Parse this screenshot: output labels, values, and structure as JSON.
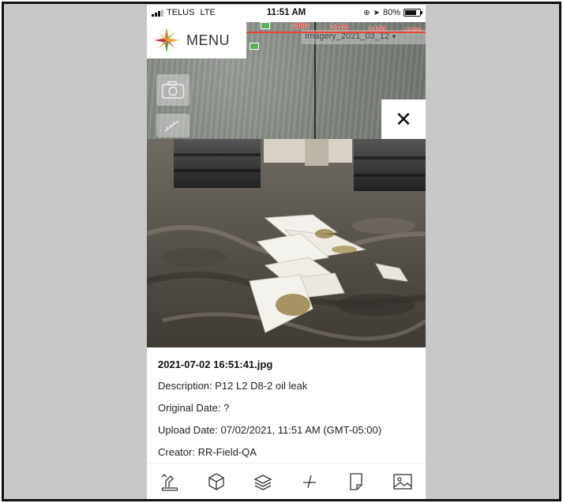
{
  "status_bar": {
    "carrier": "TELUS",
    "network": "LTE",
    "time": "11:51 AM",
    "battery": "80%"
  },
  "map": {
    "menu_label": "MENU",
    "layer_select": "Imagery_2021_03_12",
    "contour_labels": [
      "2480",
      "2470",
      "2460",
      "2450"
    ],
    "tools": [
      "camera-icon",
      "ruler-icon"
    ]
  },
  "photo": {
    "filename": "2021-07-02 16:51:41.jpg",
    "description": "Description: P12 L2 D8-2 oil leak",
    "original_date": "Original Date: ?",
    "upload_date": "Upload Date: 07/02/2021, 11:51 AM (GMT-05:00)",
    "creator": "Creator: RR-Field-QA"
  },
  "toolbar": {
    "items": [
      "excavator-icon",
      "box-icon",
      "layers-icon",
      "measure-icon",
      "document-icon",
      "image-icon"
    ]
  },
  "colors": {
    "contour_red": "#e8443a",
    "background": "#c8c8c8"
  }
}
